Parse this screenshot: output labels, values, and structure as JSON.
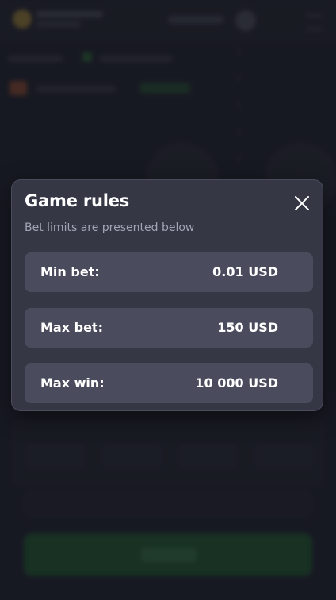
{
  "modal": {
    "title": "Game rules",
    "subtitle": "Bet limits are presented below",
    "close_icon": "close-icon",
    "rows": [
      {
        "label": "Min bet:",
        "value": "0.01 USD"
      },
      {
        "label": "Max bet:",
        "value": "150 USD"
      },
      {
        "label": "Max win:",
        "value": "10 000 USD"
      }
    ]
  },
  "colors": {
    "modal_background": "#353745",
    "row_background": "#4a4c5d",
    "play_button_green": "#1f6d2f"
  }
}
